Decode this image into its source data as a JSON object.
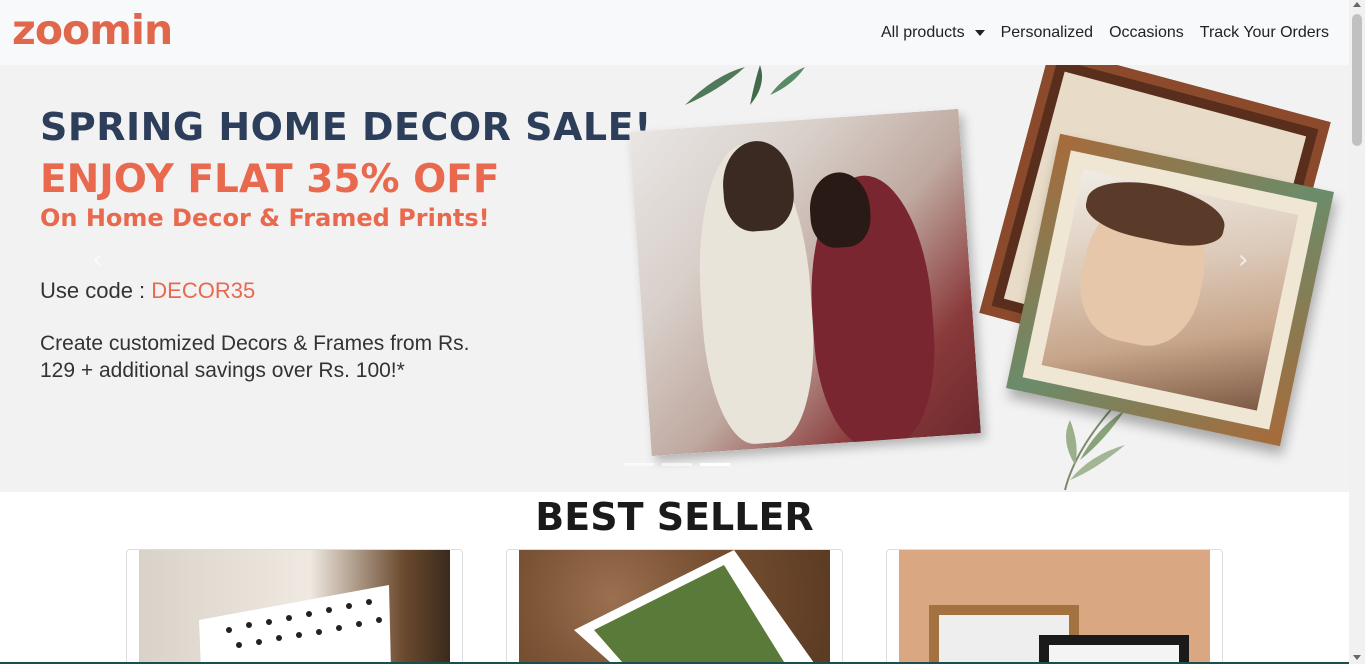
{
  "brand": {
    "logo_text": "zoomin",
    "color": "#e0674c"
  },
  "nav": {
    "items": [
      {
        "label": "All products",
        "has_dropdown": true
      },
      {
        "label": "Personalized"
      },
      {
        "label": "Occasions"
      },
      {
        "label": "Track Your Orders"
      }
    ]
  },
  "hero": {
    "headline": "SPRING HOME DECOR SALE!",
    "offer": "ENJOY FLAT 35% OFF",
    "offer_sub": "On Home Decor & Framed Prints!",
    "code_prefix": "Use code : ",
    "code": "DECOR35",
    "description": "Create customized Decors & Frames from Rs. 129 + additional savings over Rs. 100!*",
    "slides_total": 3,
    "active_slide": 3,
    "colors": {
      "headline": "#2c3e5a",
      "accent": "#e8694e",
      "background": "#f2f2f2"
    }
  },
  "best_seller": {
    "title": "BEST SELLER",
    "cards": [
      {
        "image": "photo-book"
      },
      {
        "image": "polaroid-prints"
      },
      {
        "image": "framed-prints"
      }
    ]
  }
}
